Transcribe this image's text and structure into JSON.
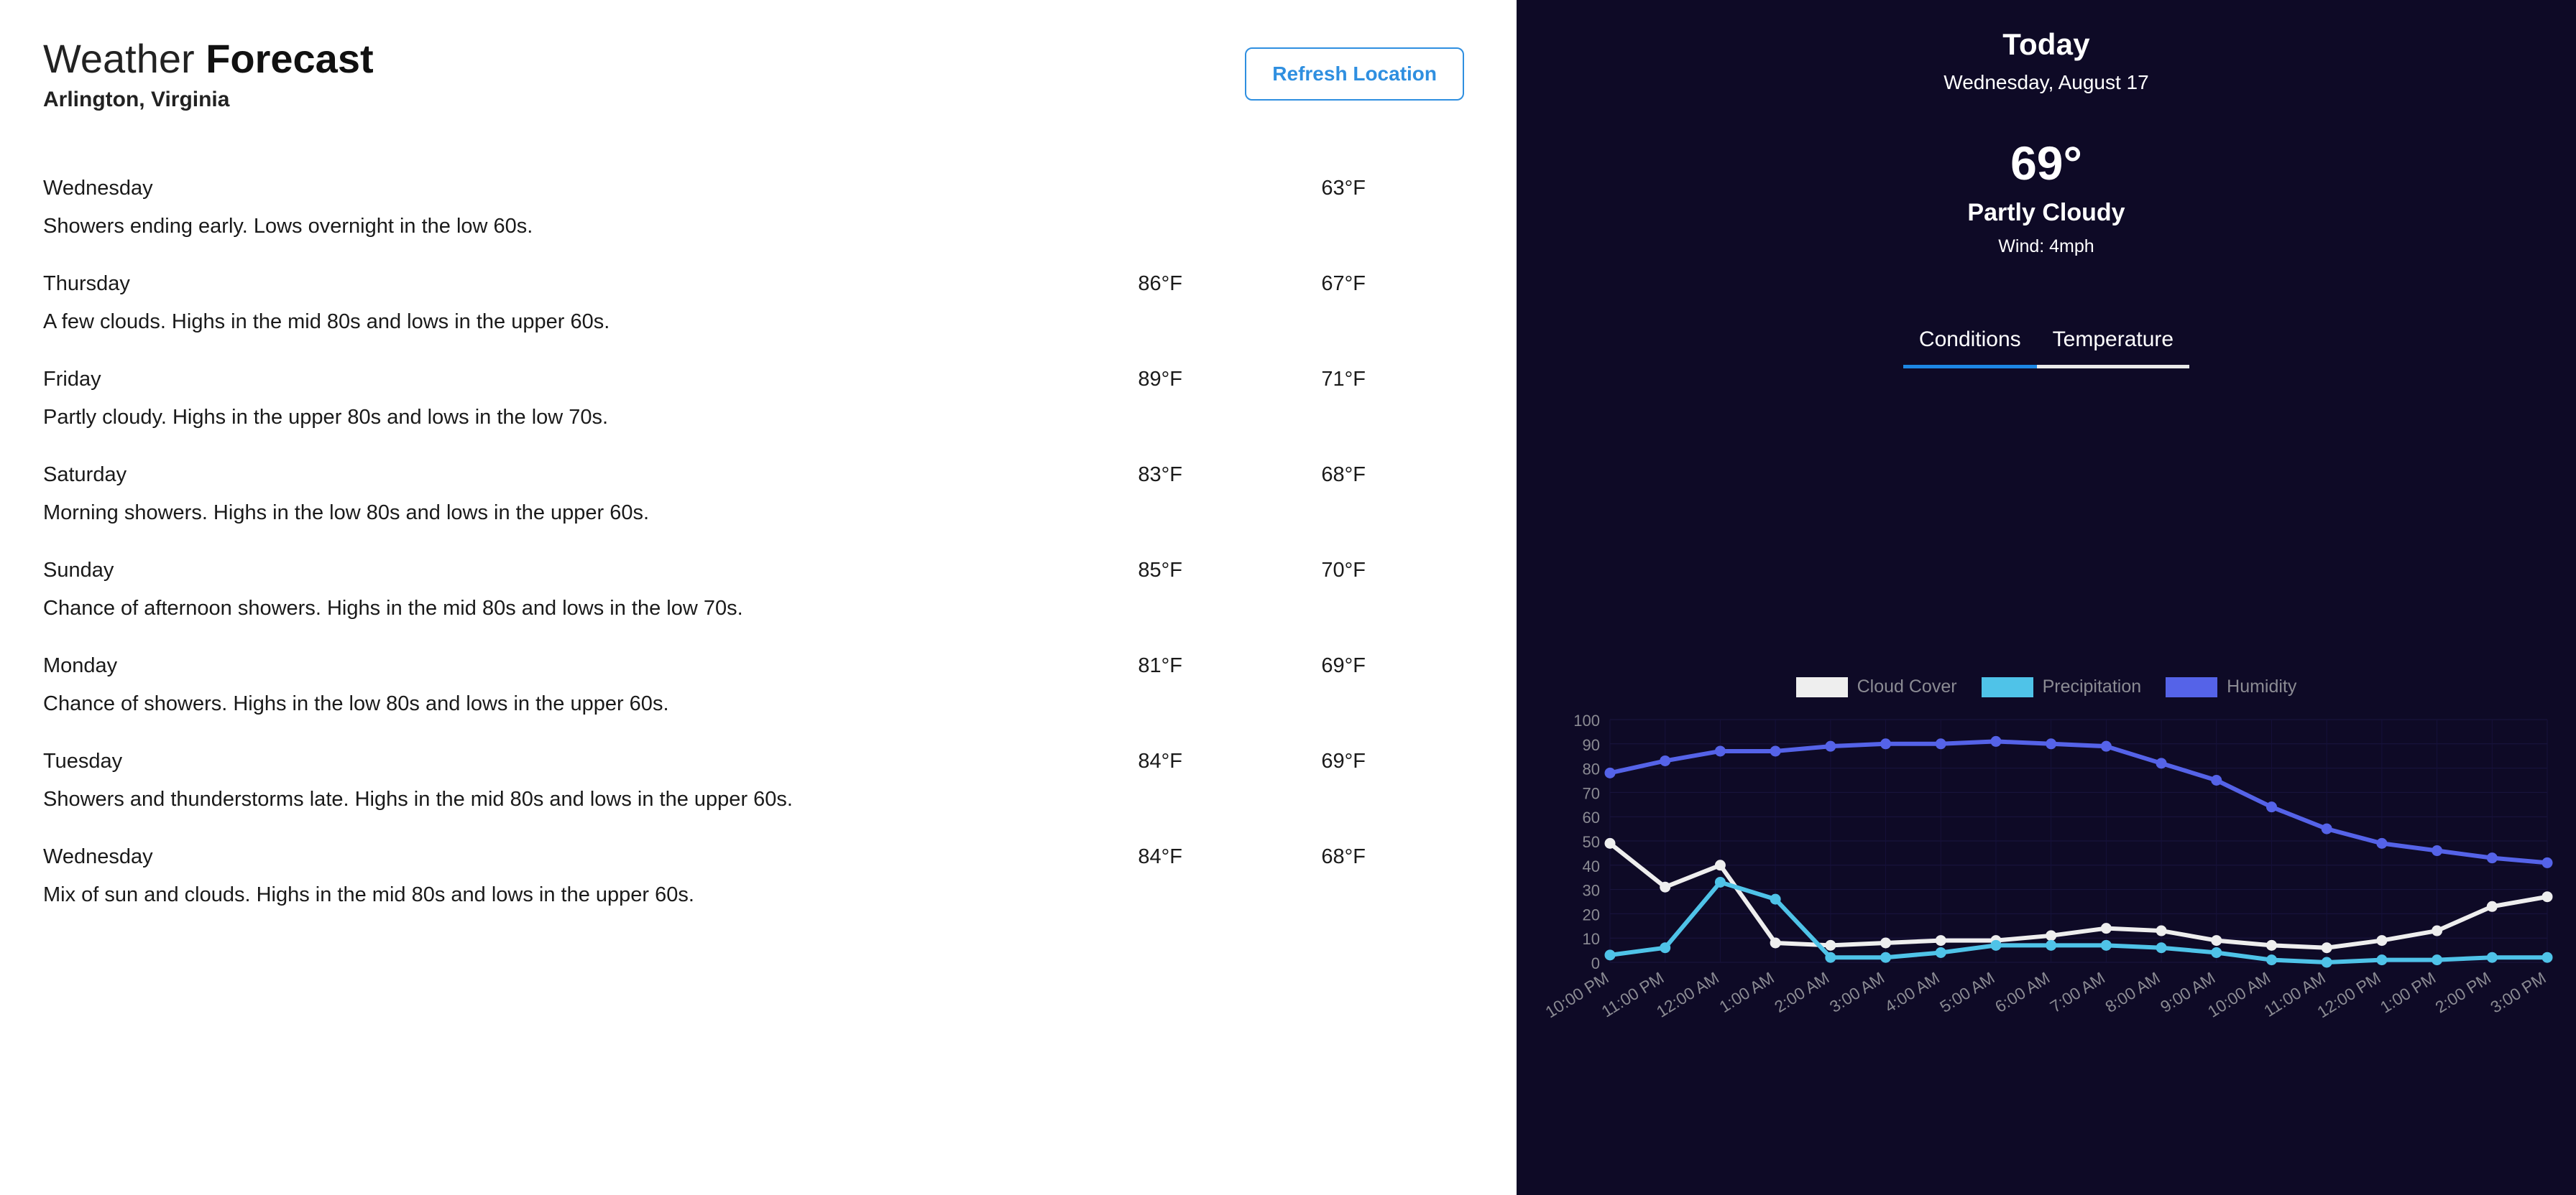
{
  "header": {
    "title_light": "Weather ",
    "title_bold": "Forecast",
    "location": "Arlington, Virginia",
    "refresh_label": "Refresh Location"
  },
  "forecast": {
    "rows": [
      {
        "day": "Wednesday",
        "high": "",
        "low": "63°F",
        "desc": "Showers ending early. Lows overnight in the low 60s."
      },
      {
        "day": "Thursday",
        "high": "86°F",
        "low": "67°F",
        "desc": "A few clouds. Highs in the mid 80s and lows in the upper 60s."
      },
      {
        "day": "Friday",
        "high": "89°F",
        "low": "71°F",
        "desc": "Partly cloudy. Highs in the upper 80s and lows in the low 70s."
      },
      {
        "day": "Saturday",
        "high": "83°F",
        "low": "68°F",
        "desc": "Morning showers. Highs in the low 80s and lows in the upper 60s."
      },
      {
        "day": "Sunday",
        "high": "85°F",
        "low": "70°F",
        "desc": "Chance of afternoon showers. Highs in the mid 80s and lows in the low 70s."
      },
      {
        "day": "Monday",
        "high": "81°F",
        "low": "69°F",
        "desc": "Chance of showers. Highs in the low 80s and lows in the upper 60s."
      },
      {
        "day": "Tuesday",
        "high": "84°F",
        "low": "69°F",
        "desc": "Showers and thunderstorms late. Highs in the mid 80s and lows in the upper 60s."
      },
      {
        "day": "Wednesday",
        "high": "84°F",
        "low": "68°F",
        "desc": "Mix of sun and clouds. Highs in the mid 80s and lows in the upper 60s."
      }
    ]
  },
  "today": {
    "label": "Today",
    "date": "Wednesday, August 17",
    "temperature": "69°",
    "condition": "Partly Cloudy",
    "wind": "Wind: 4mph"
  },
  "tabs": {
    "items": [
      {
        "label": "Conditions",
        "active": true
      },
      {
        "label": "Temperature",
        "active": false
      }
    ]
  },
  "colors": {
    "panel_bg": "#0e0a26",
    "accent_blue": "#1d87e4",
    "cloud_cover": "#eeeeee",
    "precipitation": "#4fc3e8",
    "humidity": "#5563e8",
    "axis_text": "#8b8b93"
  },
  "chart_data": {
    "type": "line",
    "title": "",
    "xlabel": "",
    "ylabel": "",
    "ylim": [
      0,
      100
    ],
    "yticks": [
      0,
      10,
      20,
      30,
      40,
      50,
      60,
      70,
      80,
      90,
      100
    ],
    "grid": true,
    "legend_position": "top-center",
    "x": [
      "10:00 PM",
      "11:00 PM",
      "12:00 AM",
      "1:00 AM",
      "2:00 AM",
      "3:00 AM",
      "4:00 AM",
      "5:00 AM",
      "6:00 AM",
      "7:00 AM",
      "8:00 AM",
      "9:00 AM",
      "10:00 AM",
      "11:00 AM",
      "12:00 PM",
      "1:00 PM",
      "2:00 PM",
      "3:00 PM"
    ],
    "series": [
      {
        "name": "Cloud Cover",
        "color": "#eeeeee",
        "values": [
          49,
          31,
          40,
          8,
          7,
          8,
          9,
          9,
          11,
          14,
          13,
          9,
          7,
          6,
          9,
          13,
          23,
          27
        ]
      },
      {
        "name": "Precipitation",
        "color": "#4fc3e8",
        "values": [
          3,
          6,
          33,
          26,
          2,
          2,
          4,
          7,
          7,
          7,
          6,
          4,
          1,
          0,
          1,
          1,
          2,
          2
        ]
      },
      {
        "name": "Humidity",
        "color": "#5563e8",
        "values": [
          78,
          83,
          87,
          87,
          89,
          90,
          90,
          91,
          90,
          89,
          82,
          75,
          64,
          55,
          49,
          46,
          43,
          41
        ]
      }
    ]
  }
}
